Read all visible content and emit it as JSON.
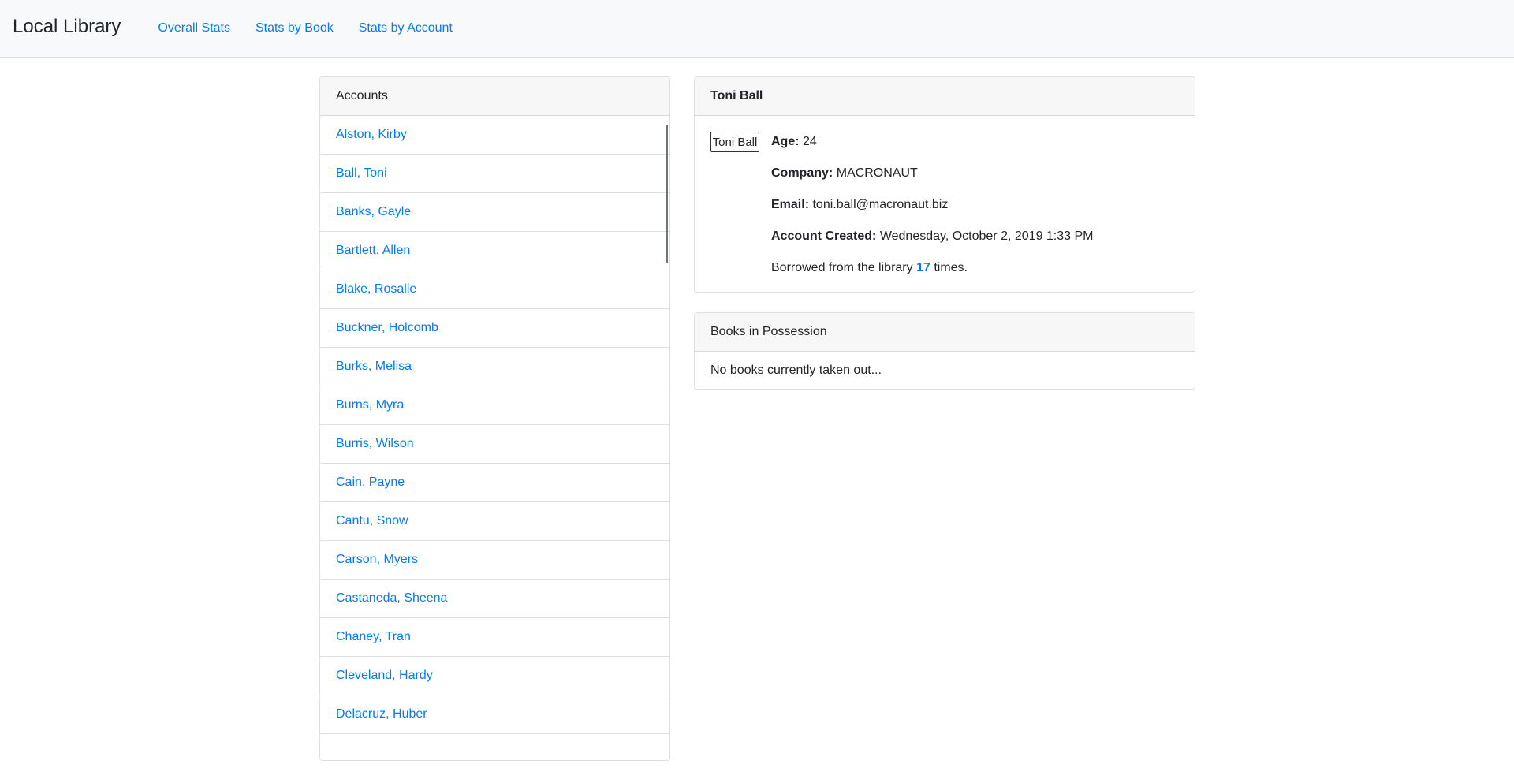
{
  "navbar": {
    "brand": "Local Library",
    "links": [
      "Overall Stats",
      "Stats by Book",
      "Stats by Account"
    ]
  },
  "accounts": {
    "header": "Accounts",
    "items": [
      "Alston, Kirby",
      "Ball, Toni",
      "Banks, Gayle",
      "Bartlett, Allen",
      "Blake, Rosalie",
      "Buckner, Holcomb",
      "Burks, Melisa",
      "Burns, Myra",
      "Burris, Wilson",
      "Cain, Payne",
      "Cantu, Snow",
      "Carson, Myers",
      "Castaneda, Sheena",
      "Chaney, Tran",
      "Cleveland, Hardy",
      "Delacruz, Huber"
    ]
  },
  "detail": {
    "name": "Toni Ball",
    "avatar_alt": "Toni Ball",
    "age_label": "Age:",
    "age": "24",
    "company_label": "Company:",
    "company": "MACRONAUT",
    "email_label": "Email:",
    "email": "toni.ball@macronaut.biz",
    "created_label": "Account Created:",
    "created": "Wednesday, October 2, 2019 1:33 PM",
    "borrowed_prefix": "Borrowed from the library",
    "borrowed_count": "17",
    "borrowed_suffix": "times."
  },
  "books": {
    "header": "Books in Possession",
    "empty_text": "No books currently taken out..."
  },
  "colors": {
    "link": "#007bff",
    "navbar_bg": "#f8f9fa",
    "card_header_bg": "#f7f7f7"
  }
}
